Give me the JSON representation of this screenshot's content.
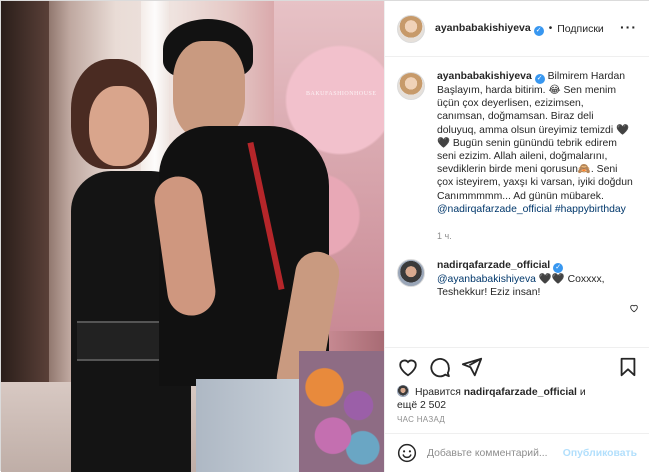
{
  "post": {
    "author": "ayanbabakishiyeva",
    "follow_label": "Подписки",
    "dot": "•",
    "more_label": "···"
  },
  "photo": {
    "watermark": "BAKUFASHIONHOUSE"
  },
  "caption": {
    "author": "ayanbabakishiyeva",
    "text_1": "Bilmirem Hardan Başlayım, harda bitirim. 😂 Sen menim üçün çox deyerlisen, ezizimsen, canımsan, doğmamsan. Biraz deli doluyuq, amma olsun üreyimiz temizdi 🖤🖤 Bugün senin günündü tebrik edirem seni ezizim. Allah aileni, doğmalarını, sevdiklerin birde meni qorusun🙈. Seni çox isteyirem, yaxşı ki varsan, iyiki doğdun Canımmmmm... Ad günün mübarek.",
    "mention": "@nadirqafarzade_official",
    "hashtag": "#happybirthday",
    "time": "1 ч."
  },
  "reply": {
    "author": "nadirqafarzade_official",
    "mention": "@ayanbabakishiyeva",
    "text": "🖤🖤 Coxxxx, Teshekkur! Eziz insan!"
  },
  "likes": {
    "prefix": "Нравится",
    "user": "nadirqafarzade_official",
    "and": "и",
    "more": "ещё 2 502"
  },
  "timestamp": "ЧАС НАЗАД",
  "comment_box": {
    "placeholder": "Добавьте комментарий...",
    "post_label": "Опубликовать"
  },
  "icons": {
    "verified": "verified-badge-icon",
    "like": "heart-icon",
    "comment": "comment-bubble-icon",
    "share": "paper-plane-icon",
    "save": "bookmark-icon",
    "emoji": "smiley-icon"
  },
  "colors": {
    "verified": "#3897f0",
    "link": "#00376b",
    "muted": "#8e8e8e",
    "post_button_disabled": "#b2dffc"
  }
}
